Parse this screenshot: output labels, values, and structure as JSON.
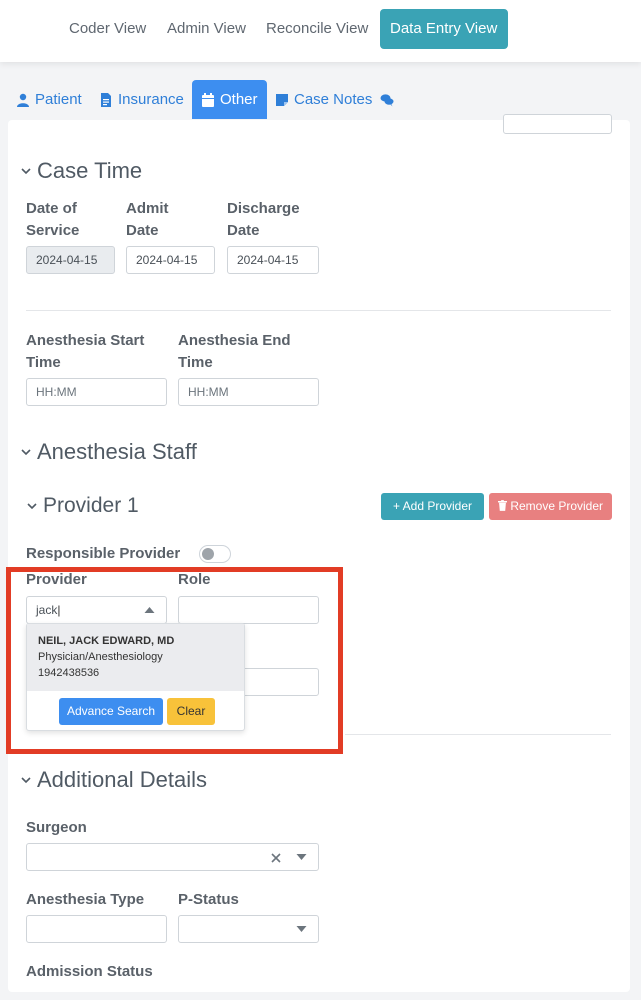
{
  "views": {
    "coder": "Coder View",
    "admin": "Admin View",
    "reconcile": "Reconcile View",
    "data_entry": "Data Entry View"
  },
  "tabs": {
    "patient": "Patient",
    "insurance": "Insurance",
    "other": "Other",
    "case_notes": "Case Notes"
  },
  "case_time": {
    "title": "Case Time",
    "date_of_service_label_1": "Date of",
    "date_of_service_label_2": "Service",
    "date_of_service": "2024-04-15",
    "admit_label_1": "Admit",
    "admit_label_2": "Date",
    "admit_date": "2024-04-15",
    "discharge_label_1": "Discharge",
    "discharge_label_2": "Date",
    "discharge_date": "2024-04-15",
    "anes_start_label_1": "Anesthesia Start",
    "anes_start_label_2": "Time",
    "anes_start_placeholder": "HH:MM",
    "anes_end_label_1": "Anesthesia End",
    "anes_end_label_2": "Time",
    "anes_end_placeholder": "HH:MM"
  },
  "anesthesia_staff": {
    "title": "Anesthesia Staff",
    "provider_title": "Provider 1",
    "add_provider": "+ Add Provider",
    "remove_provider": "Remove Provider",
    "responsible_label": "Responsible Provider",
    "provider_label": "Provider",
    "role_label": "Role",
    "provider_search_value": "jack",
    "result": {
      "name": "NEIL, JACK EDWARD, MD",
      "specialty": "Physician/Anesthesiology",
      "npi": "1942438536"
    },
    "advance_search": "Advance Search",
    "clear": "Clear"
  },
  "additional_details": {
    "title": "Additional Details",
    "surgeon_label": "Surgeon",
    "anesthesia_type_label": "Anesthesia Type",
    "p_status_label": "P-Status",
    "admission_status_label": "Admission Status"
  },
  "colors": {
    "accent_teal": "#3aa3b5",
    "accent_blue": "#3d8ef0",
    "remove_red": "#e88080",
    "clear_yellow": "#f8c23a",
    "highlight_red": "#e23c25"
  }
}
